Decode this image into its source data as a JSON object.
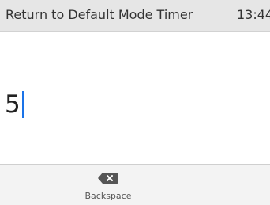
{
  "header": {
    "title": "Return to Default Mode Timer",
    "time": "13:44"
  },
  "input": {
    "value": "5"
  },
  "softkeys": [
    {
      "label": "Backspace",
      "icon": "backspace-icon"
    }
  ],
  "colors": {
    "caret": "#1a73e8",
    "header_bg": "#e6e6e6",
    "softkey_bg": "#f3f3f3"
  }
}
